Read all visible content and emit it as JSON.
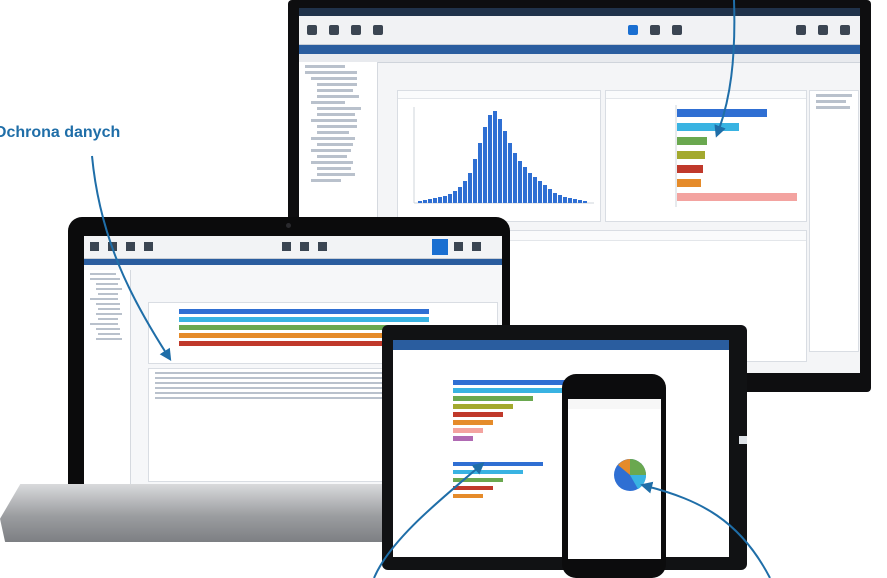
{
  "callout": {
    "label": "Ochrona danych",
    "color": "#1f6ea8"
  },
  "colors": {
    "accent": "#1a6fd1",
    "header": "#2a5d9f",
    "bar_blue": "#2f6fd3",
    "bar_cyan": "#39b3e2",
    "bar_green": "#6aa84f",
    "bar_olive": "#a3a92e",
    "bar_red": "#c0392b",
    "bar_pink": "#f3a3a0",
    "bar_orange": "#e58b2a"
  },
  "icons": [
    "dashboard-icon",
    "alert-icon",
    "reports-icon",
    "analytics-icon",
    "user-icon",
    "settings-icon",
    "help-icon",
    "shield-icon"
  ]
}
